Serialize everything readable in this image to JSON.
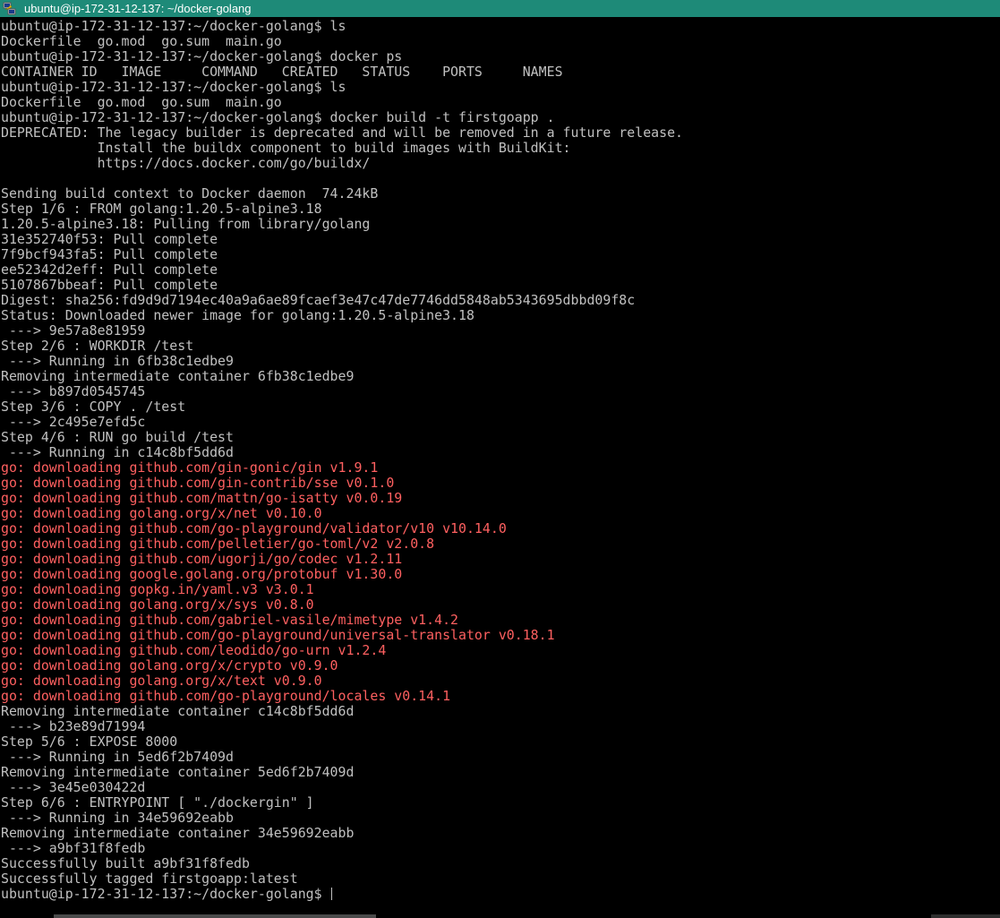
{
  "window": {
    "title": "ubuntu@ip-172-31-12-137: ~/docker-golang",
    "icon": "putty-icon"
  },
  "terminal": {
    "colors": {
      "background": "#000000",
      "foreground": "#c0c0c0",
      "error": "#ff6060",
      "titlebar": "#1e8a78"
    },
    "lines": [
      {
        "text": "ubuntu@ip-172-31-12-137:~/docker-golang$ ls",
        "kind": "normal"
      },
      {
        "text": "Dockerfile  go.mod  go.sum  main.go",
        "kind": "normal"
      },
      {
        "text": "ubuntu@ip-172-31-12-137:~/docker-golang$ docker ps",
        "kind": "normal"
      },
      {
        "text": "CONTAINER ID   IMAGE     COMMAND   CREATED   STATUS    PORTS     NAMES",
        "kind": "normal"
      },
      {
        "text": "ubuntu@ip-172-31-12-137:~/docker-golang$ ls",
        "kind": "normal"
      },
      {
        "text": "Dockerfile  go.mod  go.sum  main.go",
        "kind": "normal"
      },
      {
        "text": "ubuntu@ip-172-31-12-137:~/docker-golang$ docker build -t firstgoapp .",
        "kind": "normal"
      },
      {
        "text": "DEPRECATED: The legacy builder is deprecated and will be removed in a future release.",
        "kind": "normal"
      },
      {
        "text": "            Install the buildx component to build images with BuildKit:",
        "kind": "normal"
      },
      {
        "text": "            https://docs.docker.com/go/buildx/",
        "kind": "normal"
      },
      {
        "text": "",
        "kind": "normal"
      },
      {
        "text": "Sending build context to Docker daemon  74.24kB",
        "kind": "normal"
      },
      {
        "text": "Step 1/6 : FROM golang:1.20.5-alpine3.18",
        "kind": "normal"
      },
      {
        "text": "1.20.5-alpine3.18: Pulling from library/golang",
        "kind": "normal"
      },
      {
        "text": "31e352740f53: Pull complete",
        "kind": "normal"
      },
      {
        "text": "7f9bcf943fa5: Pull complete",
        "kind": "normal"
      },
      {
        "text": "ee52342d2eff: Pull complete",
        "kind": "normal"
      },
      {
        "text": "5107867bbeaf: Pull complete",
        "kind": "normal"
      },
      {
        "text": "Digest: sha256:fd9d9d7194ec40a9a6ae89fcaef3e47c47de7746dd5848ab5343695dbbd09f8c",
        "kind": "normal"
      },
      {
        "text": "Status: Downloaded newer image for golang:1.20.5-alpine3.18",
        "kind": "normal"
      },
      {
        "text": " ---> 9e57a8e81959",
        "kind": "normal"
      },
      {
        "text": "Step 2/6 : WORKDIR /test",
        "kind": "normal"
      },
      {
        "text": " ---> Running in 6fb38c1edbe9",
        "kind": "normal"
      },
      {
        "text": "Removing intermediate container 6fb38c1edbe9",
        "kind": "normal"
      },
      {
        "text": " ---> b897d0545745",
        "kind": "normal"
      },
      {
        "text": "Step 3/6 : COPY . /test",
        "kind": "normal"
      },
      {
        "text": " ---> 2c495e7efd5c",
        "kind": "normal"
      },
      {
        "text": "Step 4/6 : RUN go build /test",
        "kind": "normal"
      },
      {
        "text": " ---> Running in c14c8bf5dd6d",
        "kind": "normal"
      },
      {
        "text": "go: downloading github.com/gin-gonic/gin v1.9.1",
        "kind": "err"
      },
      {
        "text": "go: downloading github.com/gin-contrib/sse v0.1.0",
        "kind": "err"
      },
      {
        "text": "go: downloading github.com/mattn/go-isatty v0.0.19",
        "kind": "err"
      },
      {
        "text": "go: downloading golang.org/x/net v0.10.0",
        "kind": "err"
      },
      {
        "text": "go: downloading github.com/go-playground/validator/v10 v10.14.0",
        "kind": "err"
      },
      {
        "text": "go: downloading github.com/pelletier/go-toml/v2 v2.0.8",
        "kind": "err"
      },
      {
        "text": "go: downloading github.com/ugorji/go/codec v1.2.11",
        "kind": "err"
      },
      {
        "text": "go: downloading google.golang.org/protobuf v1.30.0",
        "kind": "err"
      },
      {
        "text": "go: downloading gopkg.in/yaml.v3 v3.0.1",
        "kind": "err"
      },
      {
        "text": "go: downloading golang.org/x/sys v0.8.0",
        "kind": "err"
      },
      {
        "text": "go: downloading github.com/gabriel-vasile/mimetype v1.4.2",
        "kind": "err"
      },
      {
        "text": "go: downloading github.com/go-playground/universal-translator v0.18.1",
        "kind": "err"
      },
      {
        "text": "go: downloading github.com/leodido/go-urn v1.2.4",
        "kind": "err"
      },
      {
        "text": "go: downloading golang.org/x/crypto v0.9.0",
        "kind": "err"
      },
      {
        "text": "go: downloading golang.org/x/text v0.9.0",
        "kind": "err"
      },
      {
        "text": "go: downloading github.com/go-playground/locales v0.14.1",
        "kind": "err"
      },
      {
        "text": "Removing intermediate container c14c8bf5dd6d",
        "kind": "normal"
      },
      {
        "text": " ---> b23e89d71994",
        "kind": "normal"
      },
      {
        "text": "Step 5/6 : EXPOSE 8000",
        "kind": "normal"
      },
      {
        "text": " ---> Running in 5ed6f2b7409d",
        "kind": "normal"
      },
      {
        "text": "Removing intermediate container 5ed6f2b7409d",
        "kind": "normal"
      },
      {
        "text": " ---> 3e45e030422d",
        "kind": "normal"
      },
      {
        "text": "Step 6/6 : ENTRYPOINT [ \"./dockergin\" ]",
        "kind": "normal"
      },
      {
        "text": " ---> Running in 34e59692eabb",
        "kind": "normal"
      },
      {
        "text": "Removing intermediate container 34e59692eabb",
        "kind": "normal"
      },
      {
        "text": " ---> a9bf31f8fedb",
        "kind": "normal"
      },
      {
        "text": "Successfully built a9bf31f8fedb",
        "kind": "normal"
      },
      {
        "text": "Successfully tagged firstgoapp:latest",
        "kind": "normal"
      }
    ],
    "prompt": "ubuntu@ip-172-31-12-137:~/docker-golang$ "
  }
}
